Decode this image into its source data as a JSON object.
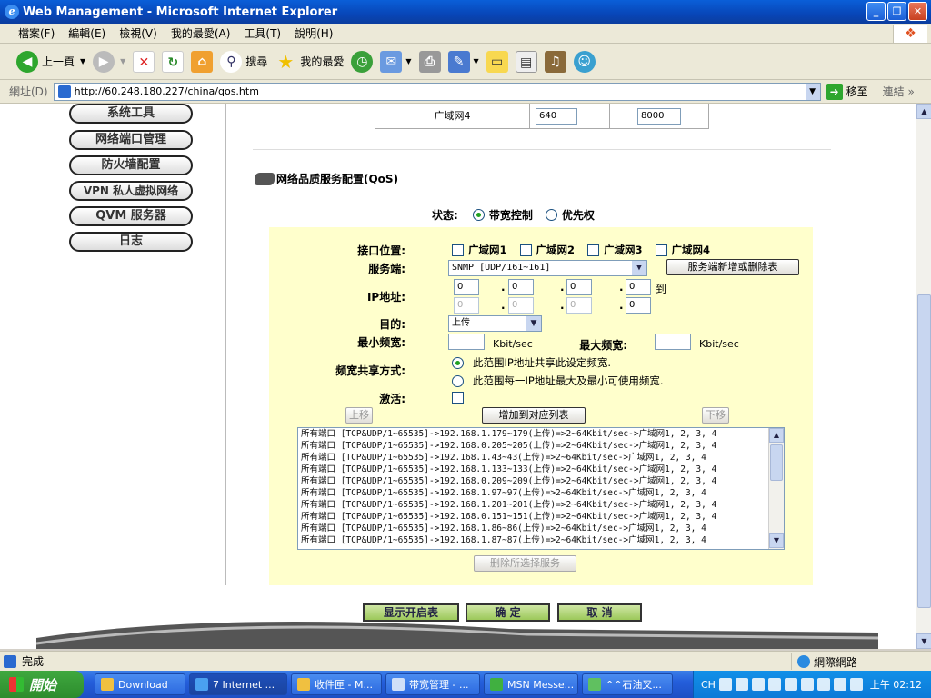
{
  "window": {
    "title": "Web Management - Microsoft Internet Explorer",
    "minimize_icon": "minimize-icon",
    "maximize_icon": "restore-icon",
    "close_icon": "close-icon"
  },
  "menu": [
    "檔案(F)",
    "編輯(E)",
    "檢視(V)",
    "我的最愛(A)",
    "工具(T)",
    "說明(H)"
  ],
  "toolbar": {
    "back": "上一頁",
    "search": "搜尋",
    "favorites": "我的最愛"
  },
  "address": {
    "label": "網址(D)",
    "url": "http://60.248.180.227/china/qos.htm",
    "go": "移至",
    "links": "連結"
  },
  "sidebar": {
    "items": [
      "系统工具",
      "网络端口管理",
      "防火墙配置",
      "VPN 私人虚拟网络",
      "QVM 服务器",
      "日志"
    ]
  },
  "top_table": {
    "label": "广域网4",
    "min_value": "640",
    "max_value": "8000"
  },
  "qos": {
    "title": "网络品质服务配置(QoS)",
    "status_label": "状态:",
    "status_options": [
      "带宽控制",
      "优先权"
    ],
    "status_selected": 0,
    "interface_label": "接口位置:",
    "interfaces": [
      "广域网1",
      "广域网2",
      "广域网3",
      "广域网4"
    ],
    "service_label": "服务端:",
    "service_value": "SNMP [UDP/161~161]",
    "service_button": "服务端新增或删除表",
    "ip_label": "IP地址:",
    "ip_start": [
      "0",
      "0",
      "0",
      "0"
    ],
    "ip_end": [
      "0",
      "0",
      "0",
      "0"
    ],
    "ip_to": "到",
    "dest_label": "目的:",
    "dest_value": "上传",
    "min_bw_label": "最小频宽:",
    "max_bw_label": "最大频宽:",
    "unit": "Kbit/sec",
    "share_label": "频宽共享方式:",
    "share_options": [
      "此范围IP地址共享此设定频宽.",
      "此范围每一IP地址最大及最小可使用频宽."
    ],
    "share_selected": 0,
    "activate_label": "激活:",
    "up_button": "上移",
    "add_button": "增加到对应列表",
    "down_button": "下移",
    "rules": [
      "所有端口 [TCP&UDP/1~65535]->192.168.1.179~179(上传)=>2~64Kbit/sec->广域网1, 2, 3, 4",
      "所有端口 [TCP&UDP/1~65535]->192.168.0.205~205(上传)=>2~64Kbit/sec->广域网1, 2, 3, 4",
      "所有端口 [TCP&UDP/1~65535]->192.168.1.43~43(上传)=>2~64Kbit/sec->广域网1, 2, 3, 4",
      "所有端口 [TCP&UDP/1~65535]->192.168.1.133~133(上传)=>2~64Kbit/sec->广域网1, 2, 3, 4",
      "所有端口 [TCP&UDP/1~65535]->192.168.0.209~209(上传)=>2~64Kbit/sec->广域网1, 2, 3, 4",
      "所有端口 [TCP&UDP/1~65535]->192.168.1.97~97(上传)=>2~64Kbit/sec->广域网1, 2, 3, 4",
      "所有端口 [TCP&UDP/1~65535]->192.168.1.201~201(上传)=>2~64Kbit/sec->广域网1, 2, 3, 4",
      "所有端口 [TCP&UDP/1~65535]->192.168.0.151~151(上传)=>2~64Kbit/sec->广域网1, 2, 3, 4",
      "所有端口 [TCP&UDP/1~65535]->192.168.1.86~86(上传)=>2~64Kbit/sec->广域网1, 2, 3, 4",
      "所有端口 [TCP&UDP/1~65535]->192.168.1.87~87(上传)=>2~64Kbit/sec->广域网1, 2, 3, 4"
    ],
    "delete_button": "删除所选择服务"
  },
  "actions": {
    "show": "显示开启表",
    "ok": "确 定",
    "cancel": "取 消"
  },
  "status_bar": {
    "text": "完成",
    "zone": "網際網路"
  },
  "taskbar": {
    "start": "開始",
    "tasks": [
      "Download",
      "7 Internet ...",
      "收件匣 - M...",
      "带宽管理 - ...",
      "MSN Messe...",
      "^^石油叉..."
    ],
    "lang": "CH",
    "clock": "上午 02:12"
  }
}
